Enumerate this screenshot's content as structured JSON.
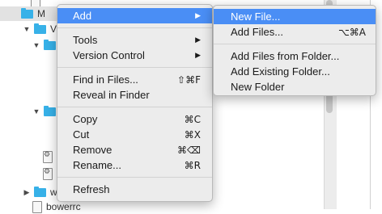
{
  "file_tree": {
    "rows": [
      {
        "label": "",
        "selected": false
      },
      {
        "label": "M",
        "selected": true
      },
      {
        "label": "Vi",
        "selected": false
      },
      {
        "label": "",
        "selected": false
      },
      {
        "label": "",
        "selected": false
      },
      {
        "label": "w",
        "selected": false
      },
      {
        "label": "bowerrc",
        "selected": false
      }
    ]
  },
  "context_menu": {
    "groups": [
      [
        {
          "label": "Add",
          "shortcut": "",
          "submenu": true,
          "highlighted": true
        }
      ],
      [
        {
          "label": "Tools",
          "shortcut": "",
          "submenu": true,
          "highlighted": false
        },
        {
          "label": "Version Control",
          "shortcut": "",
          "submenu": true,
          "highlighted": false
        }
      ],
      [
        {
          "label": "Find in Files...",
          "shortcut": "⇧⌘F",
          "submenu": false,
          "highlighted": false
        },
        {
          "label": "Reveal in Finder",
          "shortcut": "",
          "submenu": false,
          "highlighted": false
        }
      ],
      [
        {
          "label": "Copy",
          "shortcut": "⌘C",
          "submenu": false,
          "highlighted": false
        },
        {
          "label": "Cut",
          "shortcut": "⌘X",
          "submenu": false,
          "highlighted": false
        },
        {
          "label": "Remove",
          "shortcut": "⌘⌫",
          "submenu": false,
          "highlighted": false
        },
        {
          "label": "Rename...",
          "shortcut": "⌘R",
          "submenu": false,
          "highlighted": false
        }
      ],
      [
        {
          "label": "Refresh",
          "shortcut": "",
          "submenu": false,
          "highlighted": false
        }
      ]
    ],
    "submenu_arrow": "▶"
  },
  "add_submenu": {
    "groups": [
      [
        {
          "label": "New File...",
          "shortcut": "",
          "highlighted": true
        },
        {
          "label": "Add Files...",
          "shortcut": "⌥⌘A",
          "highlighted": false
        }
      ],
      [
        {
          "label": "Add Files from Folder...",
          "shortcut": "",
          "highlighted": false
        },
        {
          "label": "Add Existing Folder...",
          "shortcut": "",
          "highlighted": false
        },
        {
          "label": "New Folder",
          "shortcut": "",
          "highlighted": false
        }
      ]
    ]
  },
  "colors": {
    "highlight": "#4a8ef5",
    "folder": "#37b1e8",
    "menu_background": "#ececec"
  }
}
